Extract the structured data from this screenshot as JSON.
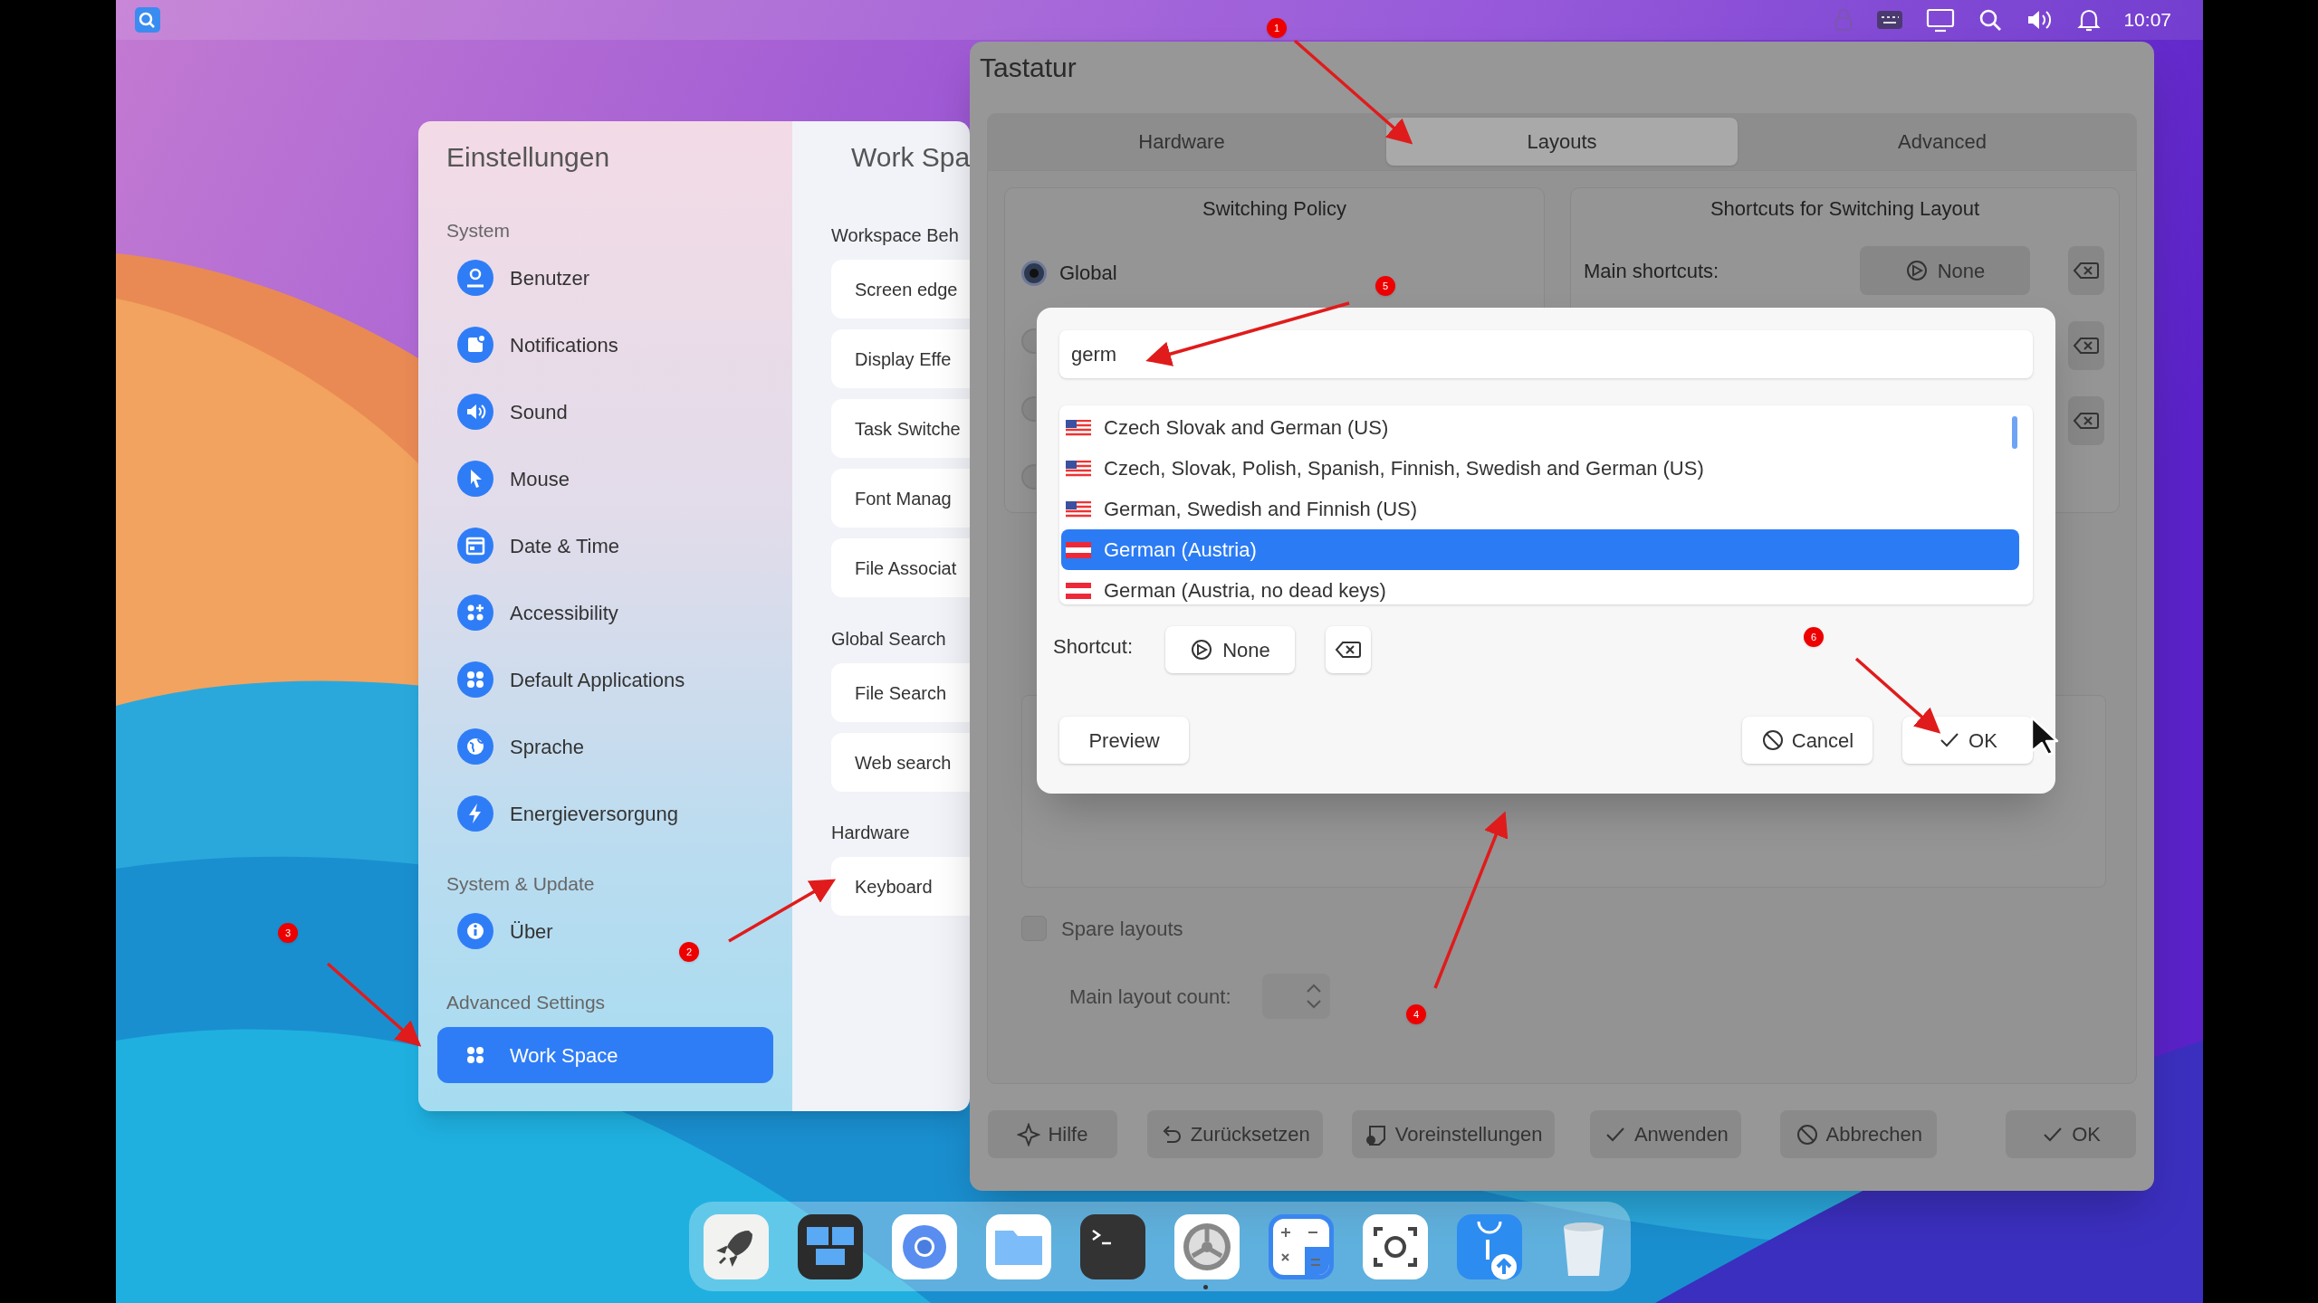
{
  "top_bar": {
    "clock": "10:07"
  },
  "settings": {
    "title": "Einstellungen",
    "sections": [
      {
        "title": "System",
        "items": [
          {
            "label": "Benutzer",
            "selected": false
          },
          {
            "label": "Notifications",
            "selected": false
          },
          {
            "label": "Sound",
            "selected": false
          },
          {
            "label": "Mouse",
            "selected": false
          },
          {
            "label": "Date & Time",
            "selected": false
          },
          {
            "label": "Accessibility",
            "selected": false
          },
          {
            "label": "Default Applications",
            "selected": false
          },
          {
            "label": "Sprache",
            "selected": false
          },
          {
            "label": "Energieversorgung",
            "selected": false
          }
        ]
      },
      {
        "title": "System & Update",
        "items": [
          {
            "label": "Über",
            "selected": false
          }
        ]
      },
      {
        "title": "Advanced Settings",
        "items": [
          {
            "label": "Work Space",
            "selected": true
          }
        ]
      }
    ],
    "content": {
      "title": "Work Spa",
      "groups": [
        {
          "title": "Workspace Beh",
          "items": [
            "Screen edge",
            "Display Effe",
            "Task Switche",
            "Font Manag",
            "File Associat"
          ]
        },
        {
          "title": "Global Search",
          "items": [
            "File Search",
            "Web search"
          ]
        },
        {
          "title": "Hardware",
          "items": [
            "Keyboard"
          ]
        }
      ]
    }
  },
  "keyboard_dialog": {
    "title": "Tastatur",
    "tabs": [
      {
        "label": "Hardware",
        "selected": false
      },
      {
        "label": "Layouts",
        "selected": true
      },
      {
        "label": "Advanced",
        "selected": false
      }
    ],
    "switching_policy": {
      "title": "Switching Policy",
      "radios": [
        {
          "label": "Global",
          "selected": true
        },
        {
          "selected": false
        },
        {
          "selected": false
        },
        {
          "selected": false
        }
      ]
    },
    "shortcuts": {
      "title": "Shortcuts for Switching Layout",
      "label": "Main shortcuts:",
      "button": "None"
    },
    "spare_layouts": {
      "label": "Spare layouts",
      "checked": false
    },
    "main_layout_count": {
      "label": "Main layout count:"
    },
    "buttons": [
      "Hilfe",
      "Zurücksetzen",
      "Voreinstellungen",
      "Anwenden",
      "Abbrechen",
      "OK"
    ]
  },
  "layout_popup": {
    "search": {
      "value": "germ"
    },
    "layouts": [
      {
        "label": "Czech Slovak and German (US)",
        "kind": "us",
        "selected": false
      },
      {
        "label": "Czech, Slovak, Polish, Spanish, Finnish, Swedish and German (US)",
        "kind": "us",
        "selected": false
      },
      {
        "label": "German, Swedish and Finnish (US)",
        "kind": "us",
        "selected": false
      },
      {
        "label": "German (Austria)",
        "kind": "at",
        "selected": true
      },
      {
        "label": "German (Austria, no dead keys)",
        "kind": "at",
        "selected": false
      }
    ],
    "shortcut_label": "Shortcut:",
    "shortcut_button": "None",
    "buttons": [
      "Preview",
      "Cancel",
      "OK"
    ]
  },
  "annotations": [
    "1",
    "3",
    "2",
    "5",
    "6",
    "4"
  ]
}
